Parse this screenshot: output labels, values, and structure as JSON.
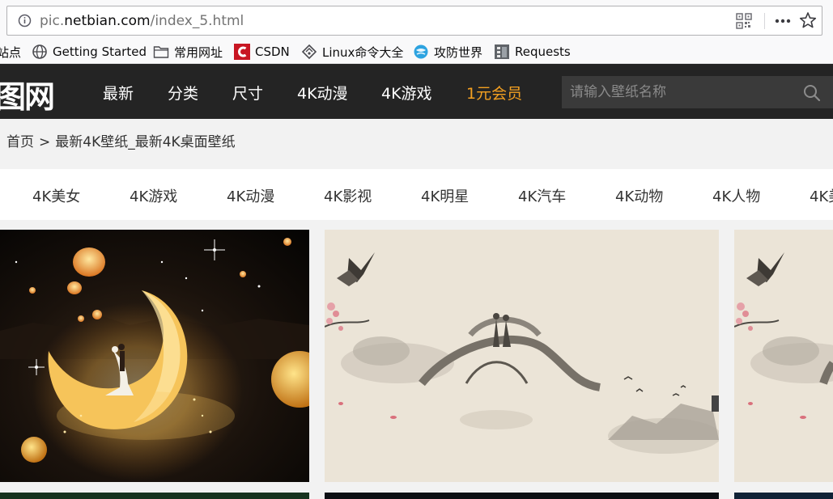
{
  "browser": {
    "url_prefix": "pic.",
    "url_domain": "netbian.com",
    "url_path": "/index_5.html",
    "icons": [
      "info-icon",
      "qr-code-icon",
      "more-icon",
      "star-icon"
    ]
  },
  "bookmarks": [
    {
      "label": "站点",
      "icon": "none"
    },
    {
      "label": "Getting Started",
      "icon": "globe-icon"
    },
    {
      "label": "常用网址",
      "icon": "folder-icon"
    },
    {
      "label": "CSDN",
      "icon": "csdn-icon"
    },
    {
      "label": "Linux命令大全",
      "icon": "linux-icon"
    },
    {
      "label": "攻防世界",
      "icon": "globe-blue-icon"
    },
    {
      "label": "Requests",
      "icon": "requests-icon"
    }
  ],
  "site": {
    "logo": "图网",
    "nav": [
      {
        "label": "最新"
      },
      {
        "label": "分类"
      },
      {
        "label": "尺寸"
      },
      {
        "label": "4K动漫"
      },
      {
        "label": "4K游戏"
      },
      {
        "label": "1元会员"
      }
    ],
    "search_placeholder": "请输入壁纸名称",
    "colors": {
      "header_bg": "#242424",
      "vip": "#f4a021",
      "page_bg": "#f2f2f2"
    }
  },
  "breadcrumb": {
    "home": "首页",
    "separator": ">",
    "current": "最新4K壁纸_最新4K桌面壁纸"
  },
  "categories": [
    "4K美女",
    "4K游戏",
    "4K动漫",
    "4K影视",
    "4K明星",
    "4K汽车",
    "4K动物",
    "4K人物",
    "4K美"
  ],
  "thumbnails": [
    {
      "description": "night-moon-couple"
    },
    {
      "description": "ink-painting-bridge-couple"
    },
    {
      "description": "ink-painting-bridge-couple-partial"
    }
  ]
}
